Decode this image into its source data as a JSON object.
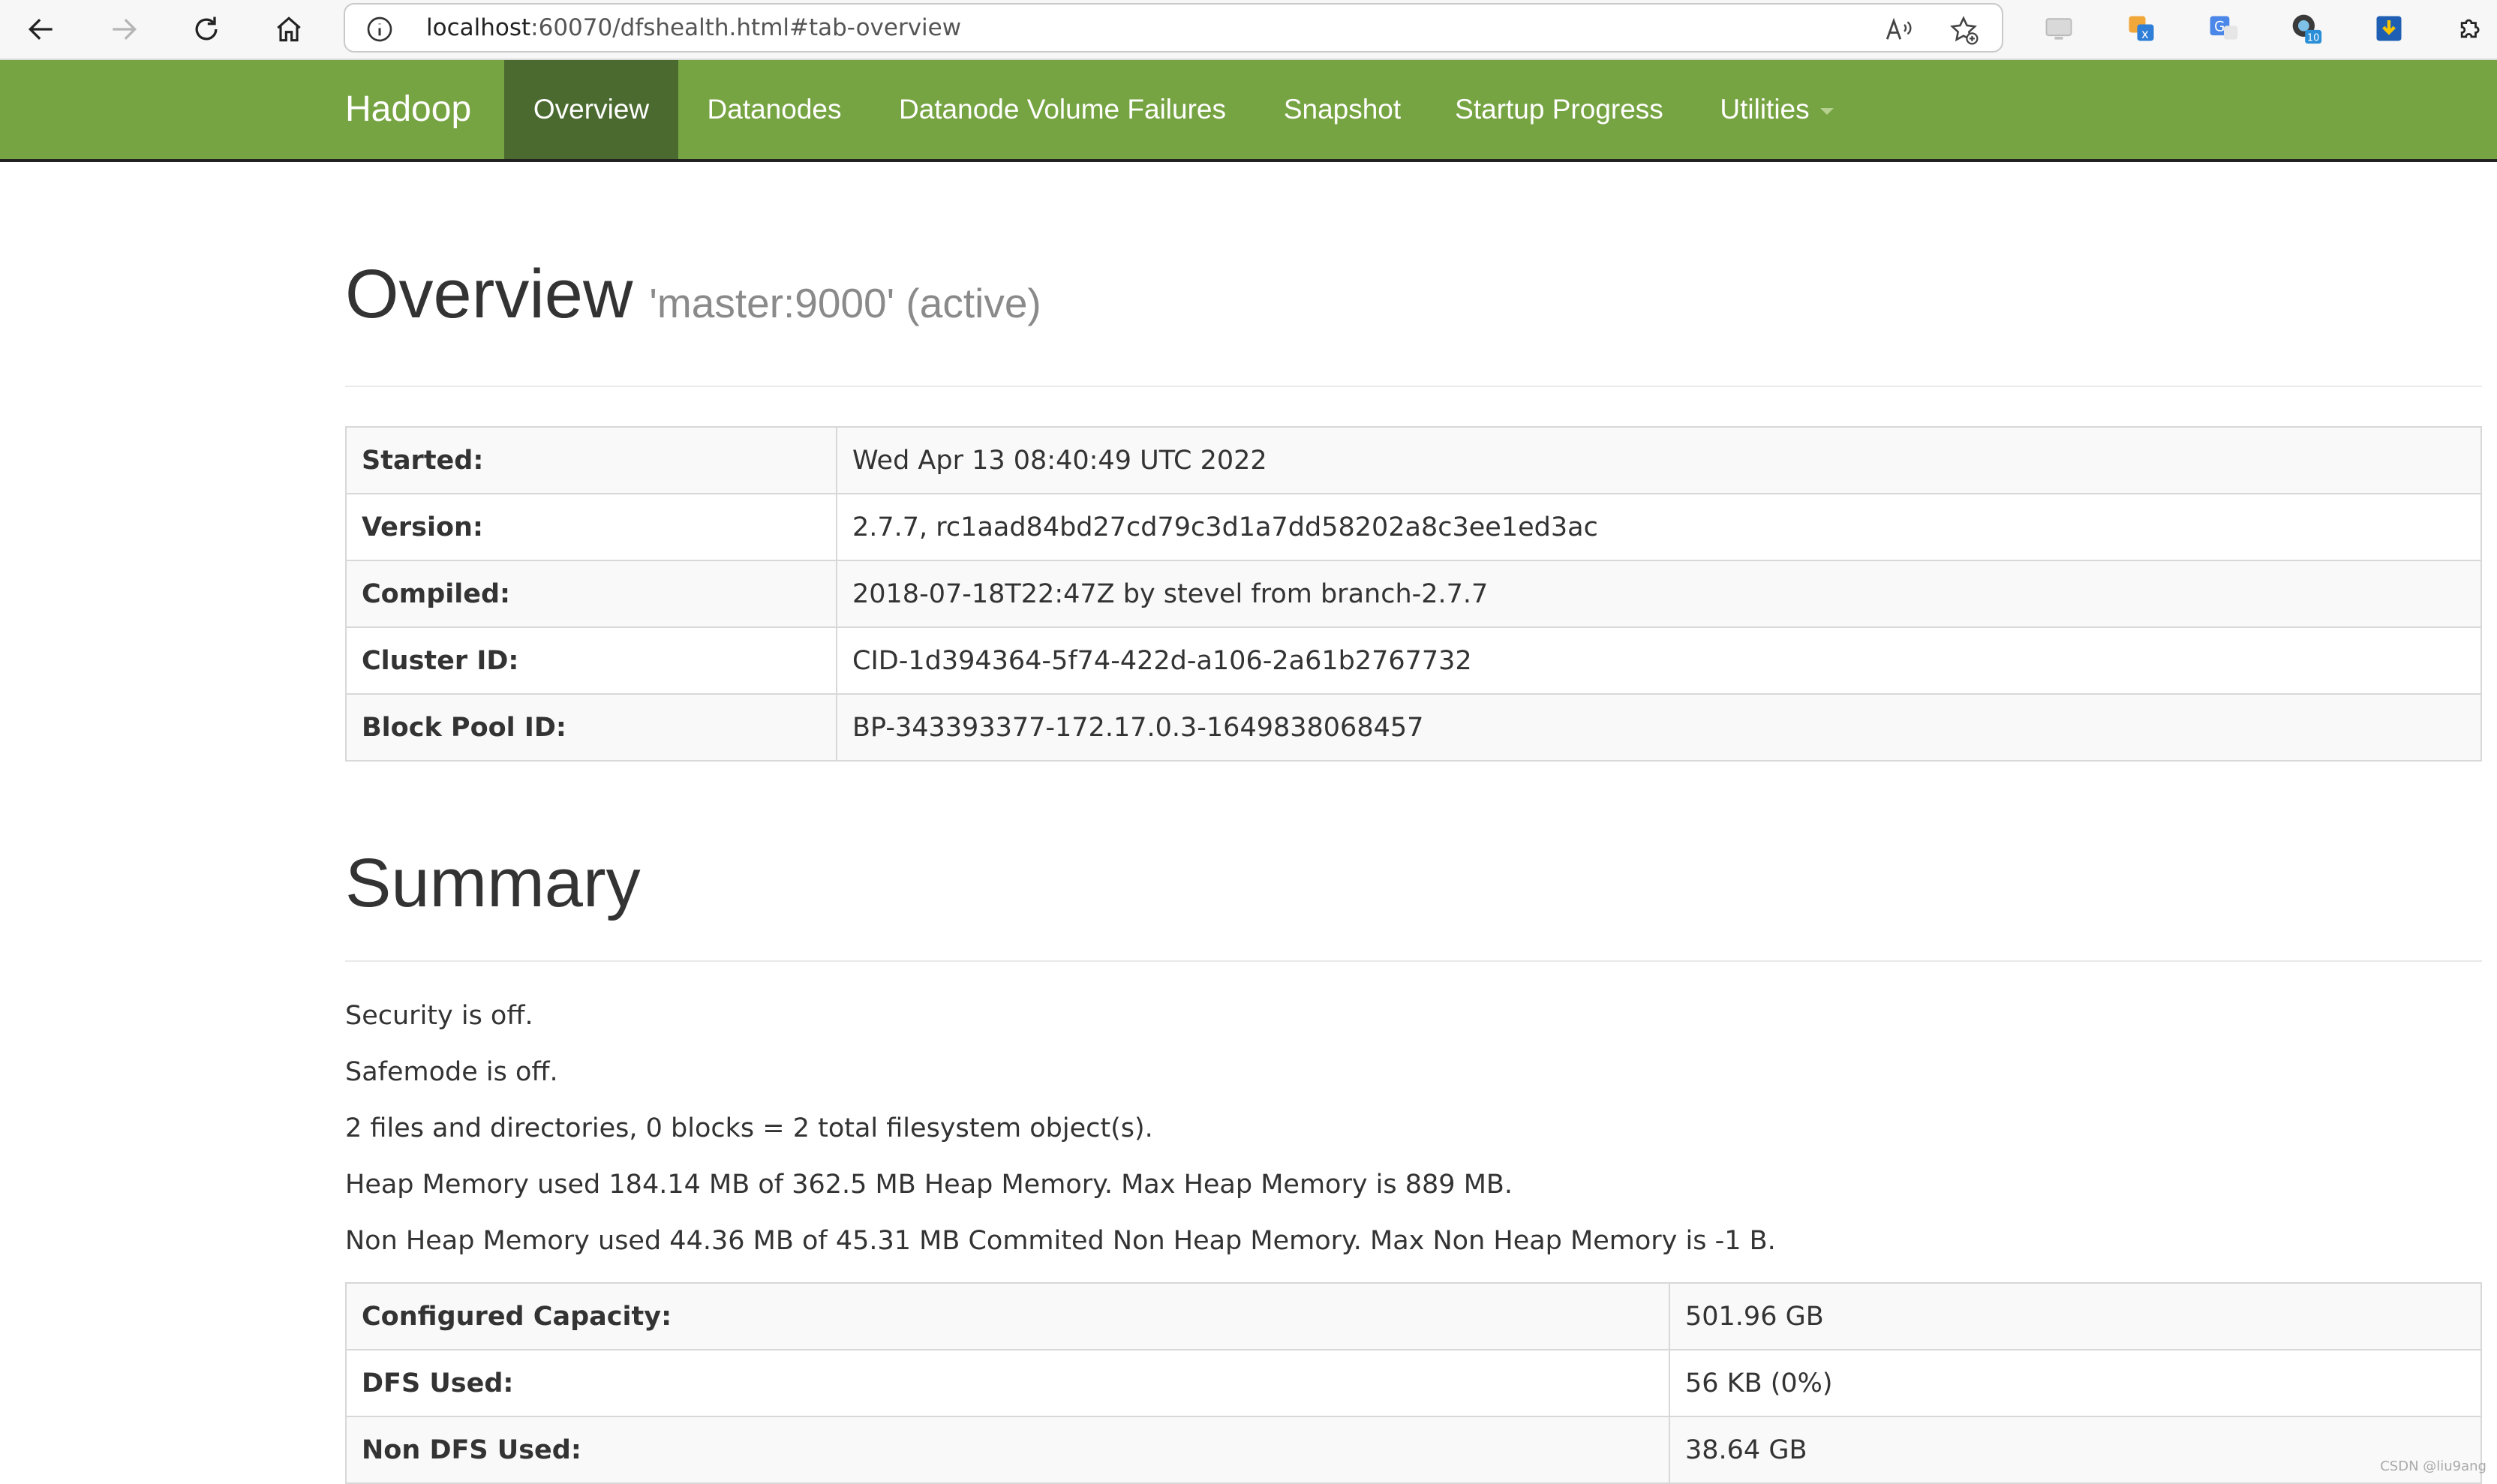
{
  "browser": {
    "url_host": "localhost",
    "url_rest": ":60070/dfshealth.html#tab-overview",
    "extension_badge": "10"
  },
  "navbar": {
    "brand": "Hadoop",
    "items": [
      {
        "label": "Overview",
        "active": true
      },
      {
        "label": "Datanodes"
      },
      {
        "label": "Datanode Volume Failures"
      },
      {
        "label": "Snapshot"
      },
      {
        "label": "Startup Progress"
      },
      {
        "label": "Utilities"
      }
    ]
  },
  "overview": {
    "title": "Overview",
    "subtitle": "'master:9000' (active)",
    "rows": [
      {
        "key": "Started:",
        "value": "Wed Apr 13 08:40:49 UTC 2022"
      },
      {
        "key": "Version:",
        "value": "2.7.7, rc1aad84bd27cd79c3d1a7dd58202a8c3ee1ed3ac"
      },
      {
        "key": "Compiled:",
        "value": "2018-07-18T22:47Z by stevel from branch-2.7.7"
      },
      {
        "key": "Cluster ID:",
        "value": "CID-1d394364-5f74-422d-a106-2a61b2767732"
      },
      {
        "key": "Block Pool ID:",
        "value": "BP-343393377-172.17.0.3-1649838068457"
      }
    ]
  },
  "summary": {
    "title": "Summary",
    "lines": [
      "Security is off.",
      "Safemode is off.",
      "2 files and directories, 0 blocks = 2 total filesystem object(s).",
      "Heap Memory used 184.14 MB of 362.5 MB Heap Memory. Max Heap Memory is 889 MB.",
      "Non Heap Memory used 44.36 MB of 45.31 MB Commited Non Heap Memory. Max Non Heap Memory is -1 B."
    ],
    "rows": [
      {
        "key": "Configured Capacity:",
        "value": "501.96 GB"
      },
      {
        "key": "DFS Used:",
        "value": "56 KB (0%)"
      },
      {
        "key": "Non DFS Used:",
        "value": "38.64 GB"
      }
    ]
  },
  "watermark": "CSDN @liu9ang"
}
